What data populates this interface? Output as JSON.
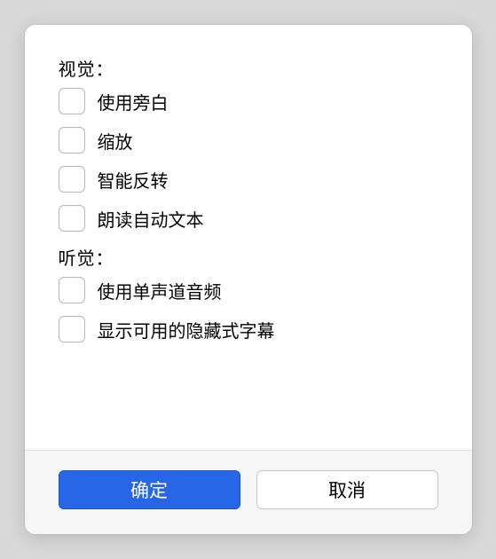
{
  "sections": {
    "visual": {
      "label": "视觉：",
      "options": [
        {
          "label": "使用旁白",
          "checked": false
        },
        {
          "label": "缩放",
          "checked": false
        },
        {
          "label": "智能反转",
          "checked": false
        },
        {
          "label": "朗读自动文本",
          "checked": false
        }
      ]
    },
    "hearing": {
      "label": "听觉：",
      "options": [
        {
          "label": "使用单声道音频",
          "checked": false
        },
        {
          "label": "显示可用的隐藏式字幕",
          "checked": false
        }
      ]
    }
  },
  "buttons": {
    "ok": "确定",
    "cancel": "取消"
  }
}
